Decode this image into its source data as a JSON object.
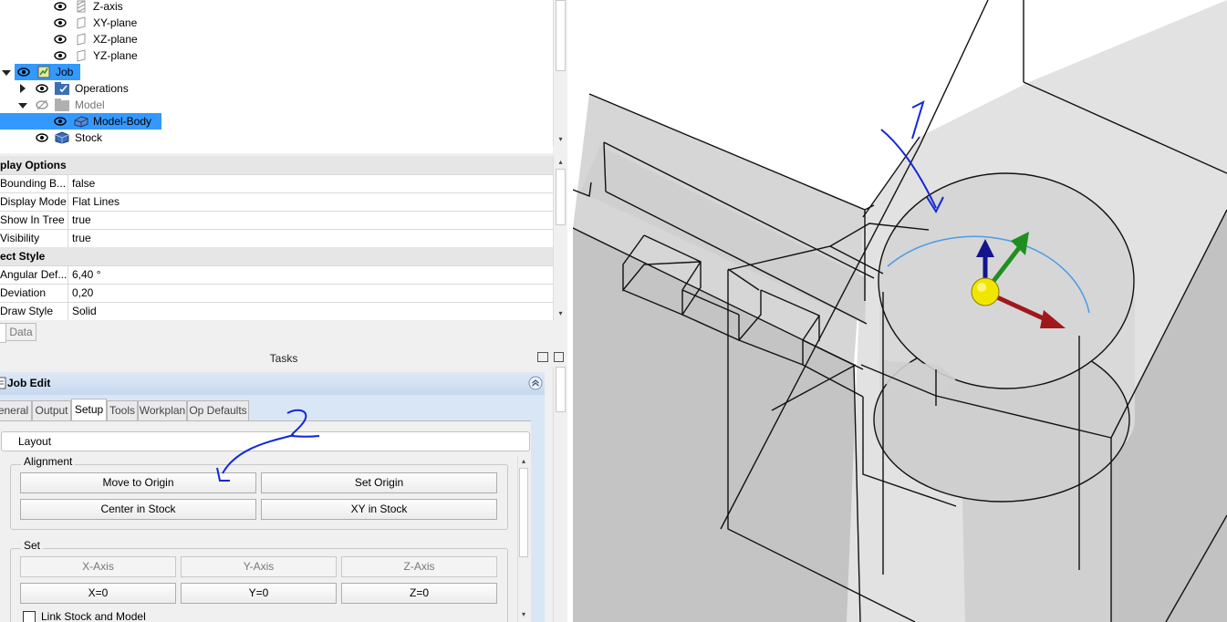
{
  "tree": {
    "items": [
      {
        "label": "Z-axis"
      },
      {
        "label": "XY-plane"
      },
      {
        "label": "XZ-plane"
      },
      {
        "label": "YZ-plane"
      },
      {
        "label": "Job"
      },
      {
        "label": "Operations"
      },
      {
        "label": "Model"
      },
      {
        "label": "Model-Body"
      },
      {
        "label": "Stock"
      }
    ]
  },
  "properties": {
    "groups": [
      {
        "title": "play Options"
      },
      {
        "title": "ect Style"
      }
    ],
    "rows": [
      {
        "key": "Bounding B...",
        "value": "false"
      },
      {
        "key": "Display Mode",
        "value": "Flat Lines"
      },
      {
        "key": "Show In Tree",
        "value": "true"
      },
      {
        "key": "Visibility",
        "value": "true"
      },
      {
        "key": "Angular Def...",
        "value": "6,40 °"
      },
      {
        "key": "Deviation",
        "value": "0,20"
      },
      {
        "key": "Draw Style",
        "value": "Solid"
      }
    ]
  },
  "bottom_tabs": {
    "data": "Data"
  },
  "tasks": {
    "title": "Tasks",
    "panel_title": "Job Edit",
    "tabs": [
      "eneral",
      "Output",
      "Setup",
      "Tools",
      "Workplan",
      "Op Defaults"
    ],
    "active_tab": "Setup",
    "layout_label": "Layout",
    "alignment": {
      "title": "Alignment",
      "buttons": [
        "Move to Origin",
        "Set Origin",
        "Center in Stock",
        "XY in Stock"
      ]
    },
    "set": {
      "title": "Set",
      "axis_buttons": [
        "X-Axis",
        "Y-Axis",
        "Z-Axis"
      ],
      "zero_buttons": [
        "X=0",
        "Y=0",
        "Z=0"
      ]
    },
    "link_checkbox": "Link Stock and Model"
  },
  "annotations": {
    "one": "1",
    "two": "2"
  },
  "colors": {
    "selection": "#3399ff",
    "x_axis": "#a0181c",
    "y_axis": "#1f8f1f",
    "z_axis": "#14148c",
    "origin": "#f2e600"
  }
}
